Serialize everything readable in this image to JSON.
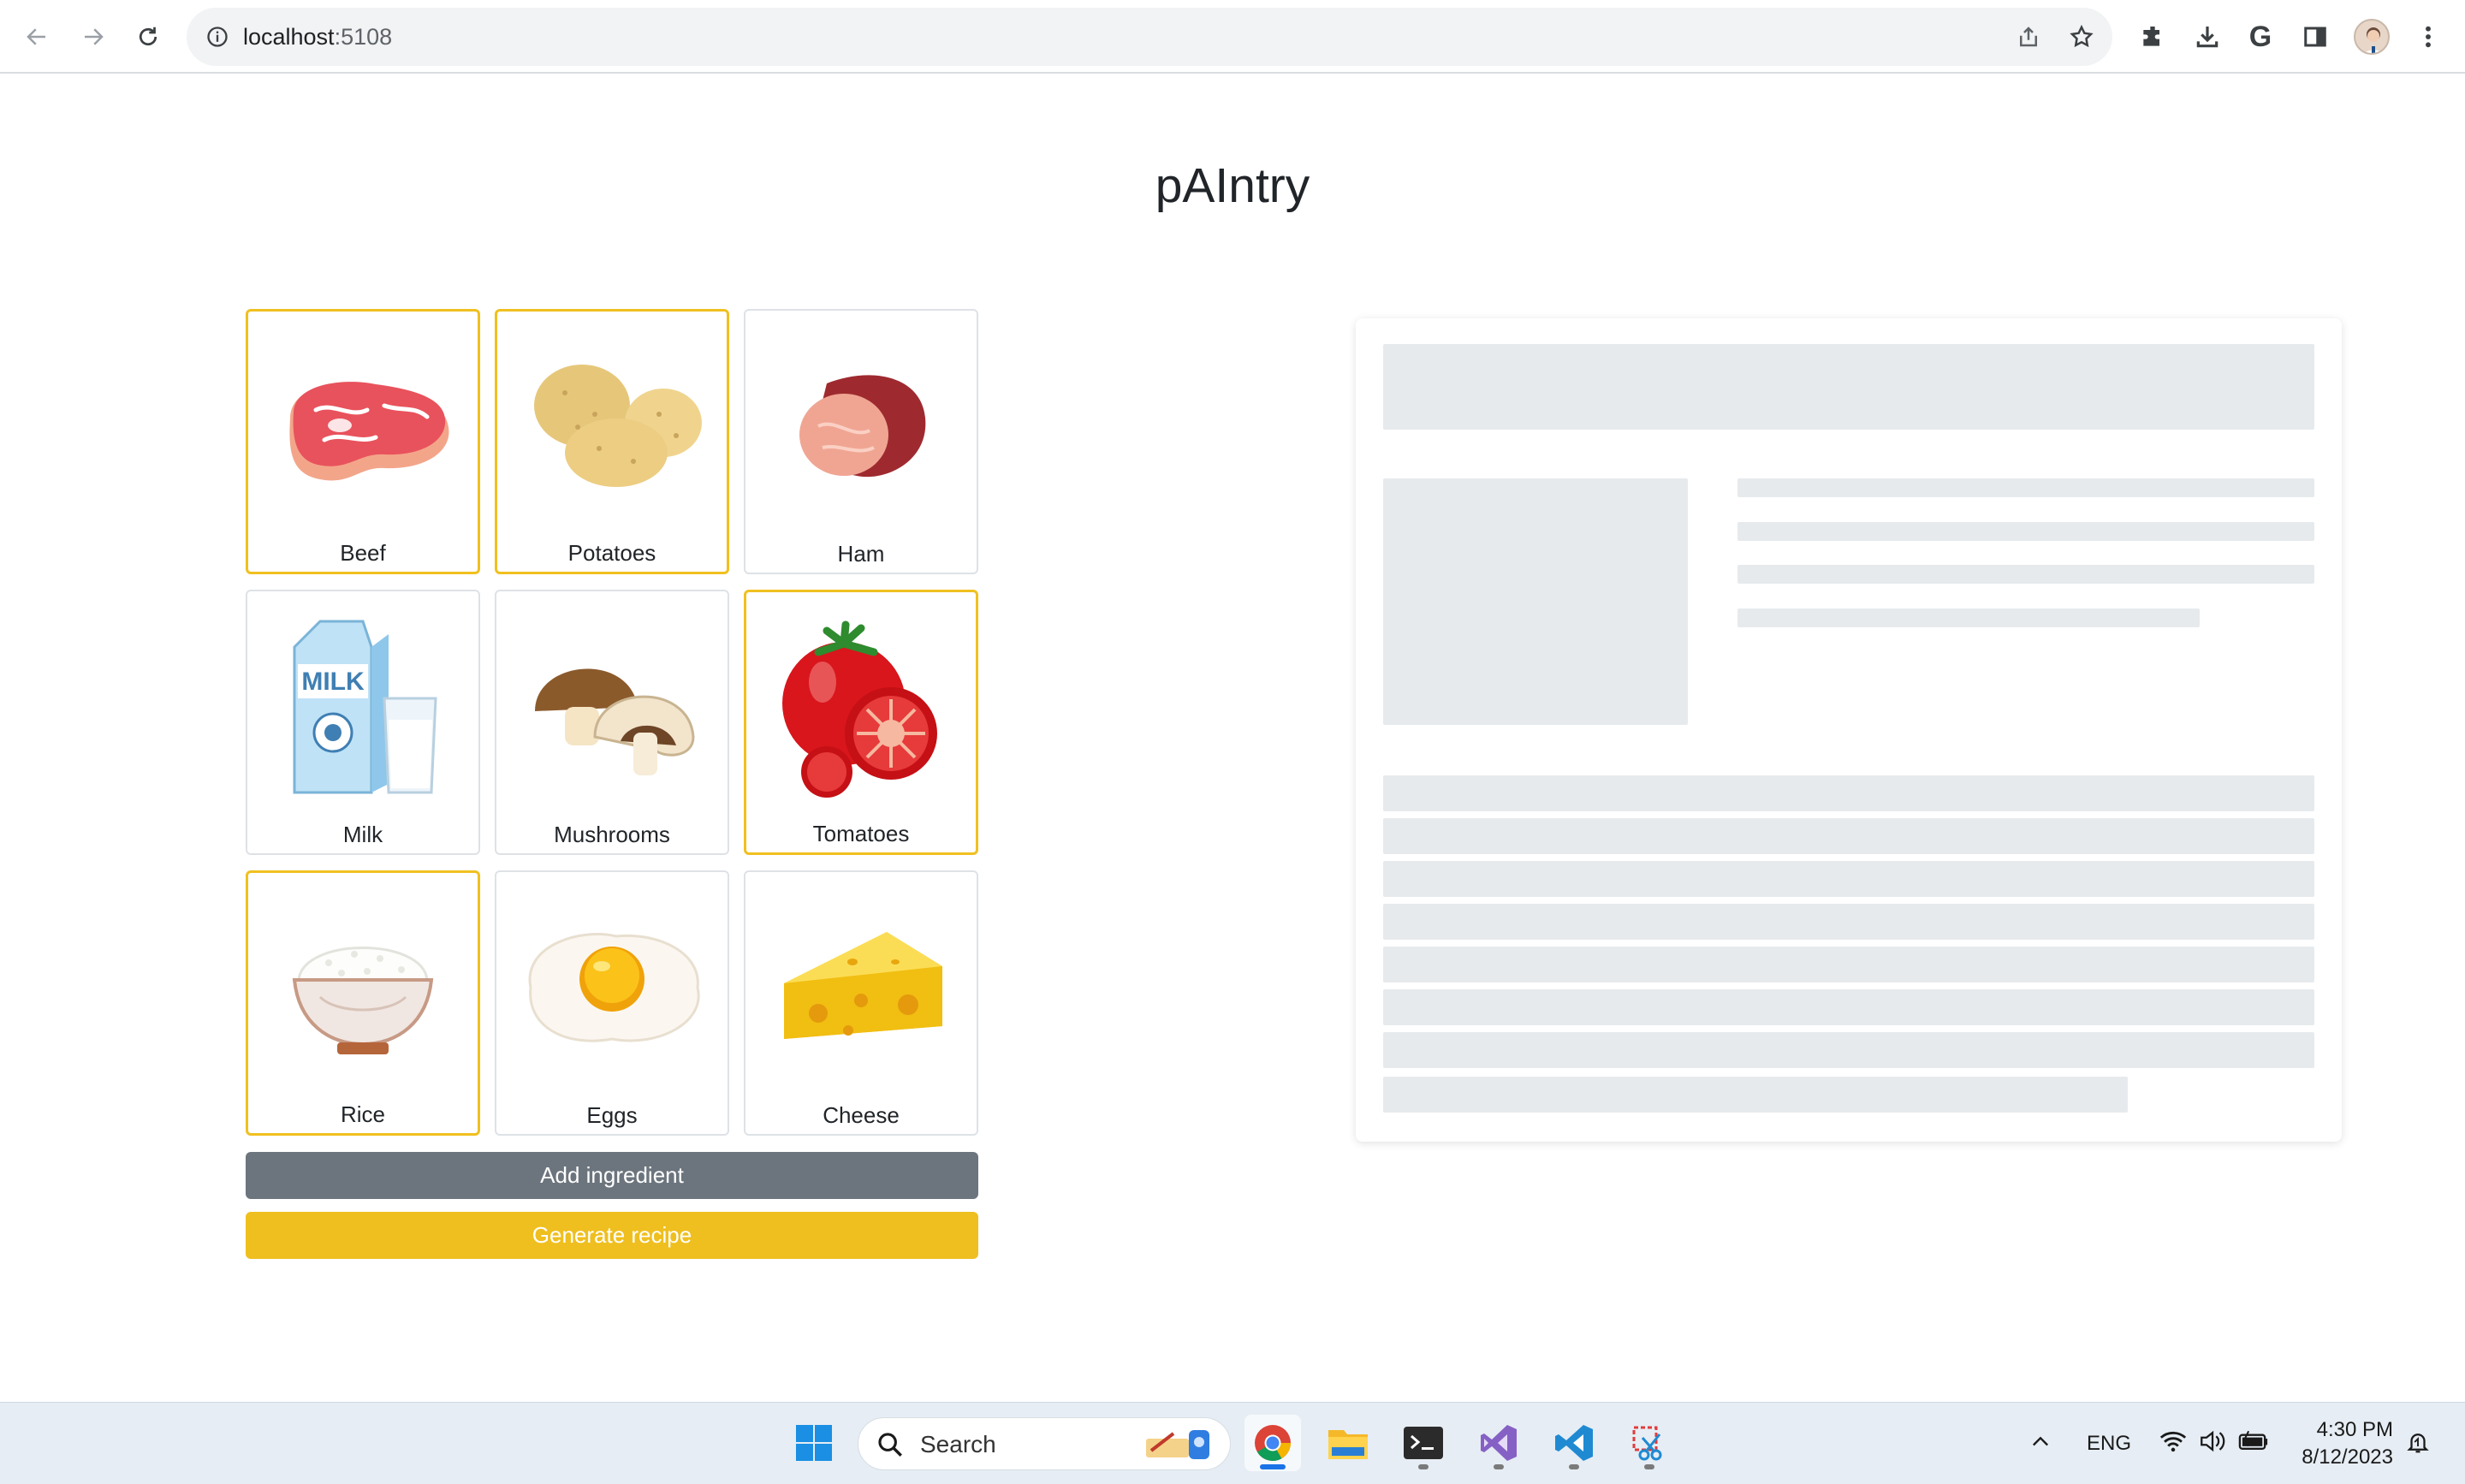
{
  "browser": {
    "url_host": "localhost",
    "url_port": ":5108",
    "icons": [
      "back-arrow-icon",
      "forward-arrow-icon",
      "reload-icon",
      "site-info-icon",
      "share-icon",
      "bookmark-star-icon",
      "extensions-icon",
      "download-icon",
      "google-icon",
      "side-panel-icon",
      "profile-avatar",
      "menu-kebab-icon"
    ],
    "google_letter": "G"
  },
  "page": {
    "title": "pAIntry"
  },
  "ingredients": [
    {
      "name": "Beef",
      "selected": true,
      "icon": "steak-icon"
    },
    {
      "name": "Potatoes",
      "selected": true,
      "icon": "potatoes-icon"
    },
    {
      "name": "Ham",
      "selected": false,
      "icon": "ham-icon"
    },
    {
      "name": "Milk",
      "selected": false,
      "icon": "milk-carton-icon"
    },
    {
      "name": "Mushrooms",
      "selected": false,
      "icon": "mushrooms-icon"
    },
    {
      "name": "Tomatoes",
      "selected": true,
      "icon": "tomatoes-icon"
    },
    {
      "name": "Rice",
      "selected": true,
      "icon": "rice-bowl-icon"
    },
    {
      "name": "Eggs",
      "selected": false,
      "icon": "fried-egg-icon"
    },
    {
      "name": "Cheese",
      "selected": false,
      "icon": "cheese-icon"
    }
  ],
  "milk_carton_text": "MILK",
  "buttons": {
    "add": "Add ingredient",
    "generate": "Generate recipe"
  },
  "colors": {
    "selected_border": "#f0c020",
    "add_button": "#6c757d",
    "generate_button": "#efbf1f",
    "placeholder": "#e7eaed"
  },
  "taskbar": {
    "search_placeholder": "Search",
    "language": "ENG",
    "time": "4:30 PM",
    "date": "8/12/2023",
    "apps": [
      "windows-start-icon",
      "chrome-icon",
      "file-explorer-icon",
      "terminal-icon",
      "visual-studio-icon",
      "vscode-icon",
      "snipping-tool-icon"
    ]
  }
}
